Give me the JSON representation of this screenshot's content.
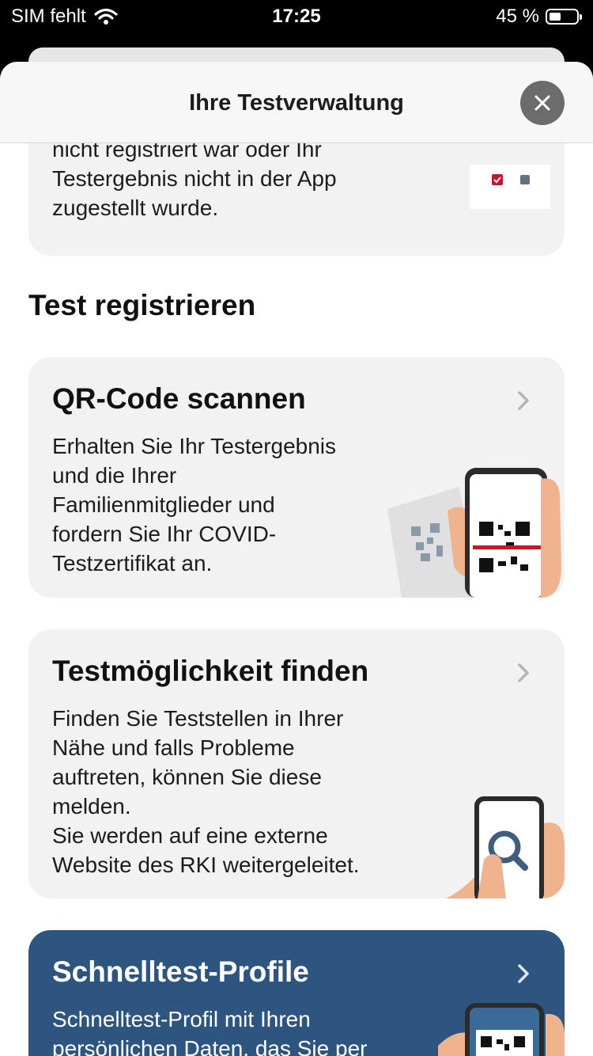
{
  "status_bar": {
    "carrier": "SIM fehlt",
    "time": "17:25",
    "battery_percent": "45 %",
    "battery_level": 0.45
  },
  "header": {
    "title": "Ihre Testverwaltung"
  },
  "previous_card": {
    "line1": "nicht registriert war oder Ihr",
    "line2": "Testergebnis nicht in der App",
    "line3": "zugestellt wurde."
  },
  "section": {
    "title": "Test registrieren"
  },
  "cards": [
    {
      "title": "QR-Code scannen",
      "lines": [
        "Erhalten Sie Ihr Testergebnis",
        "und die Ihrer",
        "Familienmitglieder und",
        "fordern Sie Ihr COVID-",
        "Testzertifikat an."
      ]
    },
    {
      "title": "Testmöglichkeit finden",
      "lines": [
        "Finden Sie Teststellen in Ihrer",
        "Nähe und falls Probleme",
        "auftreten, können Sie diese",
        "melden.",
        "Sie werden auf eine externe",
        "Website des RKI weitergeleitet."
      ]
    },
    {
      "title": "Schnelltest-Profile",
      "lines": [
        "Schnelltest-Profil mit Ihren",
        "persönlichen Daten, das Sie per"
      ]
    }
  ],
  "icons": {
    "close": "close-icon",
    "chevron": "chevron-right-icon",
    "wifi": "wifi-icon",
    "battery": "battery-icon"
  },
  "colors": {
    "card_bg": "#f2f2f2",
    "profile_card_bg": "#2e5580",
    "close_bg": "#6c6c6c",
    "accent_red": "#c4172c"
  }
}
